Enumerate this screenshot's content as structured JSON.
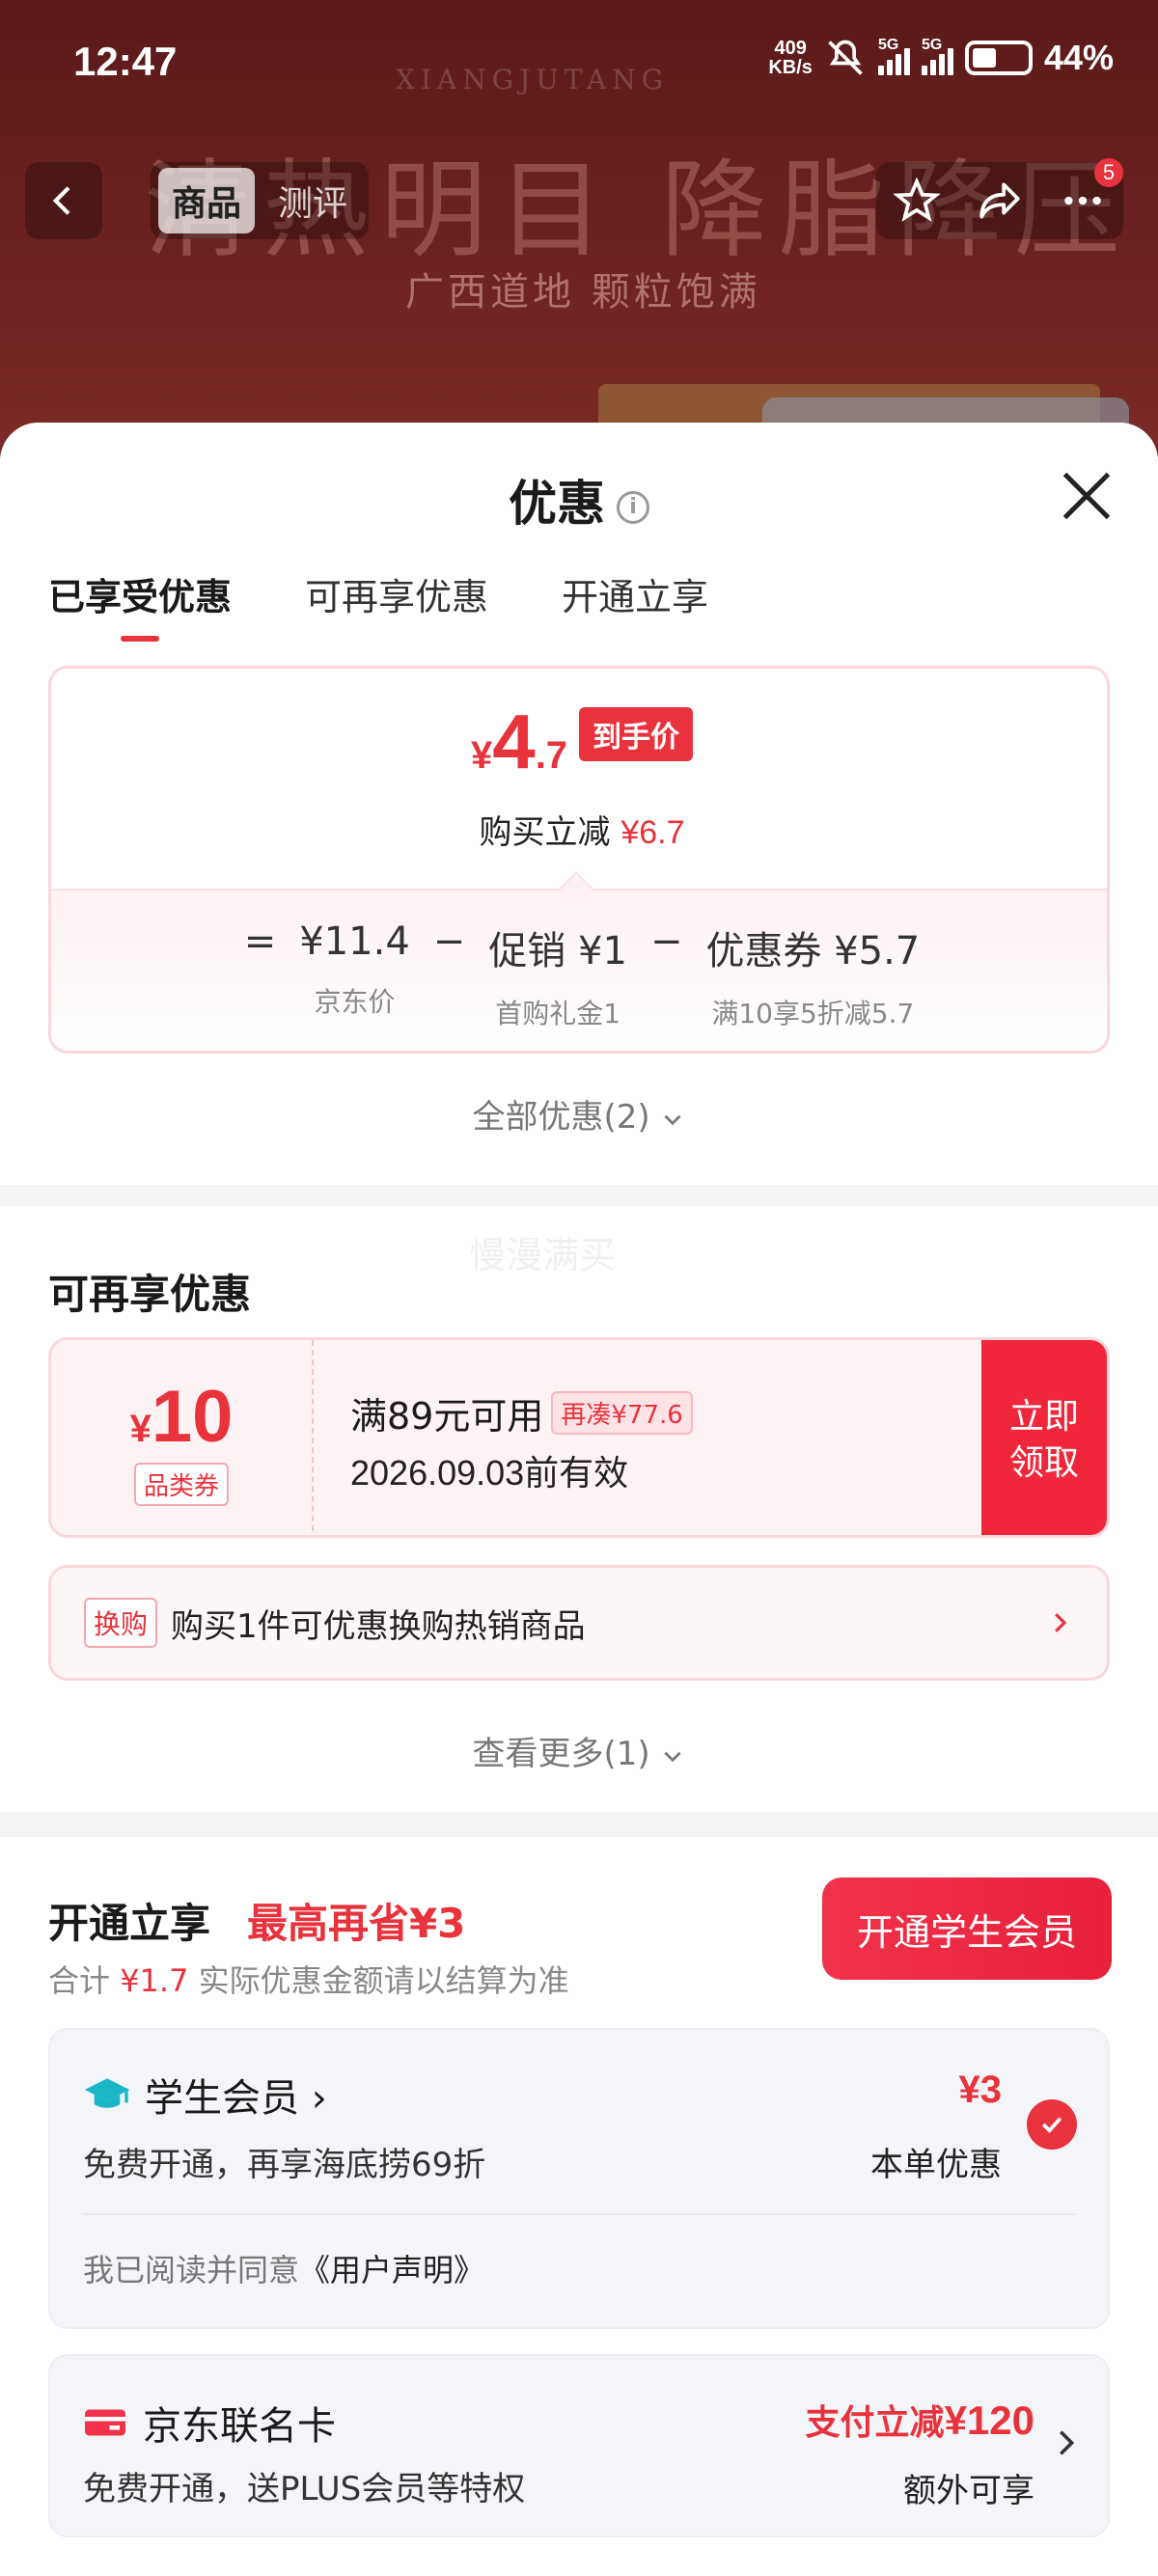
{
  "status_bar": {
    "time": "12:47",
    "net_speed": "409",
    "net_unit": "KB/s",
    "sim1": "5G",
    "sim2": "5G",
    "battery": "44%"
  },
  "background": {
    "brand": "XIANGJUTANG",
    "headline": "清热明目 降脂降压",
    "sub": "广西道地 颗粒饱满"
  },
  "nav": {
    "tabs": [
      {
        "label": "商品"
      },
      {
        "label": "测评"
      }
    ],
    "badge": "5"
  },
  "sheet": {
    "title": "优惠",
    "tabs": [
      {
        "label": "已享受优惠"
      },
      {
        "label": "可再享优惠"
      },
      {
        "label": "开通立享"
      }
    ],
    "final_price": {
      "currency": "¥",
      "integer": "4",
      "decimal": ".7",
      "tag": "到手价"
    },
    "instant_reduce": {
      "label": "购买立减",
      "amount": "¥6.7"
    },
    "calc": {
      "equals": "=",
      "minus": "−",
      "jd_price": {
        "value": "¥11.4",
        "label": "京东价"
      },
      "promo": {
        "value": "促销 ¥1",
        "label": "首购礼金1"
      },
      "coupon": {
        "value": "优惠券 ¥5.7",
        "label": "满10享5折减5.7"
      }
    },
    "all_discounts": "全部优惠(2)",
    "watermark": "慢漫满买",
    "more_section": {
      "title": "可再享优惠",
      "coupon": {
        "currency": "¥",
        "amount": "10",
        "type": "品类券",
        "condition": "满89元可用",
        "extra": "再凑¥77.6",
        "validity": "2026.09.03前有效",
        "button_line1": "立即",
        "button_line2": "领取"
      },
      "exchange": {
        "tag": "换购",
        "text": "购买1件可优惠换购热销商品"
      },
      "see_more": "查看更多(1)"
    },
    "open_section": {
      "title": "开通立享",
      "max_save": "最高再省¥3",
      "sub_prefix": "合计",
      "sub_amount": "¥1.7",
      "sub_suffix": "实际优惠金额请以结算为准",
      "button": "开通学生会员",
      "student": {
        "name": "学生会员 ›",
        "desc": "免费开通，再享海底捞69折",
        "amount": "¥3",
        "single": "本单优惠",
        "agree_prefix": "我已阅读并同意",
        "agree_link": "《用户声明》"
      },
      "jd_card": {
        "name": "京东联名卡",
        "desc": "免费开通，送PLUS会员等特权",
        "pay_prefix": "支付立减",
        "pay_amount": "¥120",
        "extra": "额外可享"
      }
    }
  },
  "colors": {
    "accent": "#e8323c",
    "student_icon": "#1bb5c8",
    "card_icon": "#f0334a"
  }
}
